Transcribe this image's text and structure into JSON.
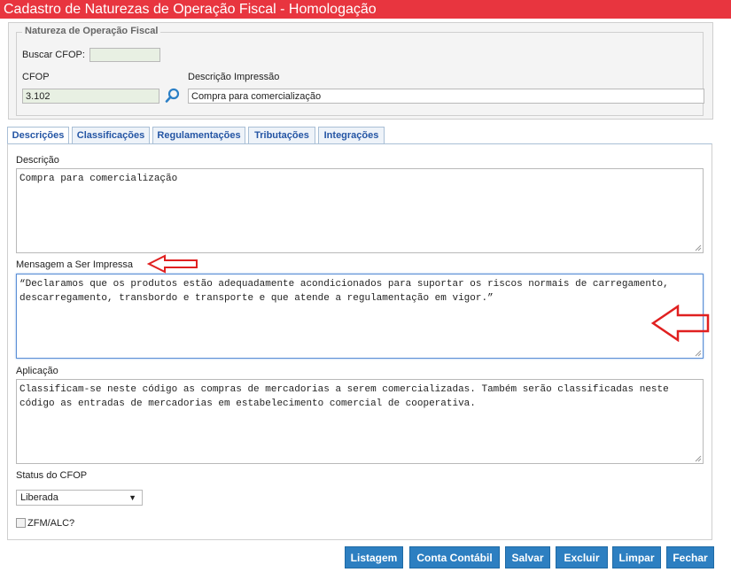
{
  "window": {
    "title": "Cadastro de Naturezas de Operação Fiscal - Homologação"
  },
  "header": {
    "legend": "Natureza de Operação Fiscal",
    "buscar_label": "Buscar CFOP:",
    "buscar_value": "",
    "cfop_label": "CFOP",
    "cfop_value": "3.102",
    "descricao_impressao_label": "Descrição Impressão",
    "descricao_impressao_value": "Compra para comercialização"
  },
  "tabs": [
    {
      "label": "Descrições",
      "active": true
    },
    {
      "label": "Classificações",
      "active": false
    },
    {
      "label": "Regulamentações",
      "active": false
    },
    {
      "label": "Tributações",
      "active": false
    },
    {
      "label": "Integrações",
      "active": false
    }
  ],
  "form": {
    "descricao_label": "Descrição",
    "descricao_value": "Compra para comercialização",
    "mensagem_label": "Mensagem a Ser Impressa",
    "mensagem_value": "“Declaramos que os produtos estão adequadamente acondicionados para suportar os riscos normais de carregamento, descarregamento, transbordo e transporte e que atende a regulamentação em vigor.”",
    "aplicacao_label": "Aplicação",
    "aplicacao_value": "Classificam-se neste código as compras de mercadorias a serem comercializadas. Também serão classificadas neste código as entradas de mercadorias em estabelecimento comercial de cooperativa.",
    "status_label": "Status do CFOP",
    "status_value": "Liberada",
    "zfm_label": "ZFM/ALC?"
  },
  "buttons": {
    "listagem": "Listagem",
    "conta_contabil": "Conta Contábil",
    "salvar": "Salvar",
    "excluir": "Excluir",
    "limpar": "Limpar",
    "fechar": "Fechar"
  },
  "colors": {
    "title_bar": "#e8353f",
    "button": "#2d7fc1",
    "tab_text": "#2455a4",
    "annotation_arrow": "#e02020"
  }
}
